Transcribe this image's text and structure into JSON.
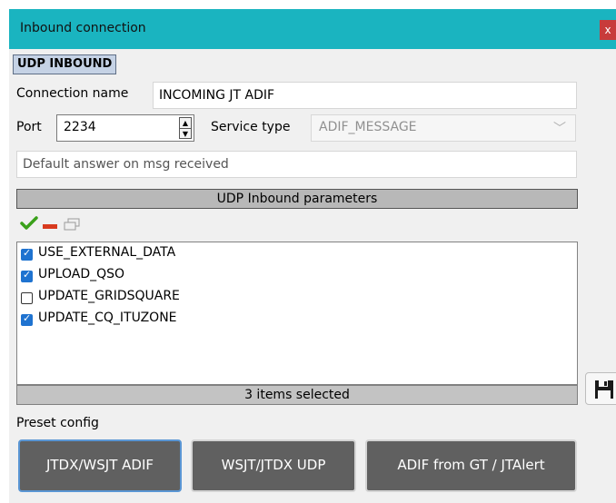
{
  "window": {
    "title": "Inbound connection",
    "close_label": "x"
  },
  "section": {
    "tag": "UDP INBOUND"
  },
  "form": {
    "connection_name_label": "Connection name",
    "connection_name_value": "INCOMING JT ADIF",
    "port_label": "Port",
    "port_value": "2234",
    "service_type_label": "Service type",
    "service_type_value": "ADIF_MESSAGE",
    "default_answer_placeholder": "Default answer on msg received"
  },
  "params": {
    "header": "UDP Inbound parameters",
    "toolbar_icons": [
      "checkmark-icon",
      "minus-icon",
      "window-icon"
    ],
    "items": [
      {
        "label": "USE_EXTERNAL_DATA",
        "checked": true
      },
      {
        "label": "UPLOAD_QSO",
        "checked": true
      },
      {
        "label": "UPDATE_GRIDSQUARE",
        "checked": false
      },
      {
        "label": "UPDATE_CQ_ITUZONE",
        "checked": true
      }
    ],
    "status": "3 items selected"
  },
  "save_icon": "floppy-disk-icon",
  "colors": {
    "titlebar": "#1ab4c0",
    "checkbox_checked": "#1f73d0",
    "preset_button": "#606060",
    "focus_border": "#5a96d4"
  },
  "presets": {
    "label": "Preset config",
    "buttons": [
      "JTDX/WSJT ADIF",
      "WSJT/JTDX UDP",
      "ADIF from GT / JTAlert"
    ]
  }
}
